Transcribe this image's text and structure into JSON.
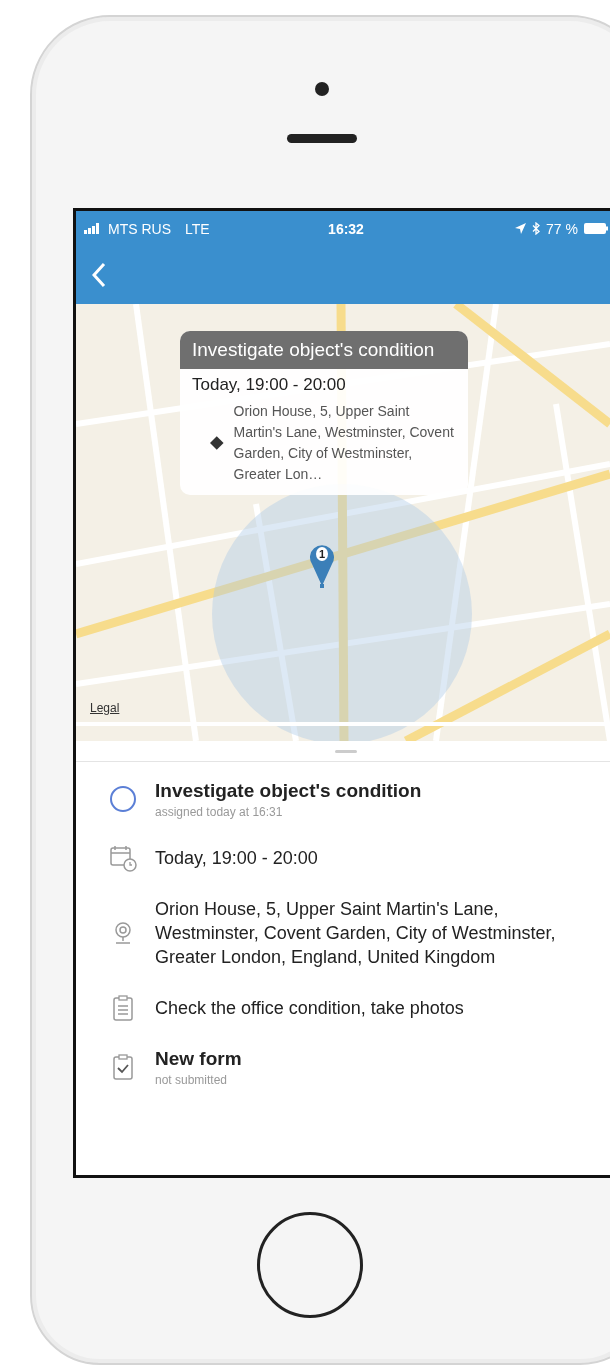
{
  "status_bar": {
    "carrier": "MTS RUS",
    "network": "LTE",
    "time": "16:32",
    "battery": "77 %"
  },
  "map": {
    "callout": {
      "title": "Investigate object's condition",
      "time": "Today, 19:00 - 20:00",
      "address": "Orion House, 5, Upper Saint Martin's Lane, Westminster, Covent Garden, City of Westminster, Greater Lon…"
    },
    "pin": {
      "label": "1"
    },
    "legal": "Legal"
  },
  "details": [
    {
      "kind": "task",
      "title": "Investigate object's condition",
      "subtitle": "assigned today at 16:31",
      "completed": false
    },
    {
      "kind": "time",
      "title": "Today, 19:00 - 20:00"
    },
    {
      "kind": "address",
      "title": "Orion House, 5, Upper Saint Martin's Lane, Westminster, Covent Garden, City of Westminster, Greater London, England, United Kingdom"
    },
    {
      "kind": "note",
      "title": "Check the office condition, take photos"
    },
    {
      "kind": "form",
      "title": "New form",
      "subtitle": "not submitted"
    }
  ]
}
